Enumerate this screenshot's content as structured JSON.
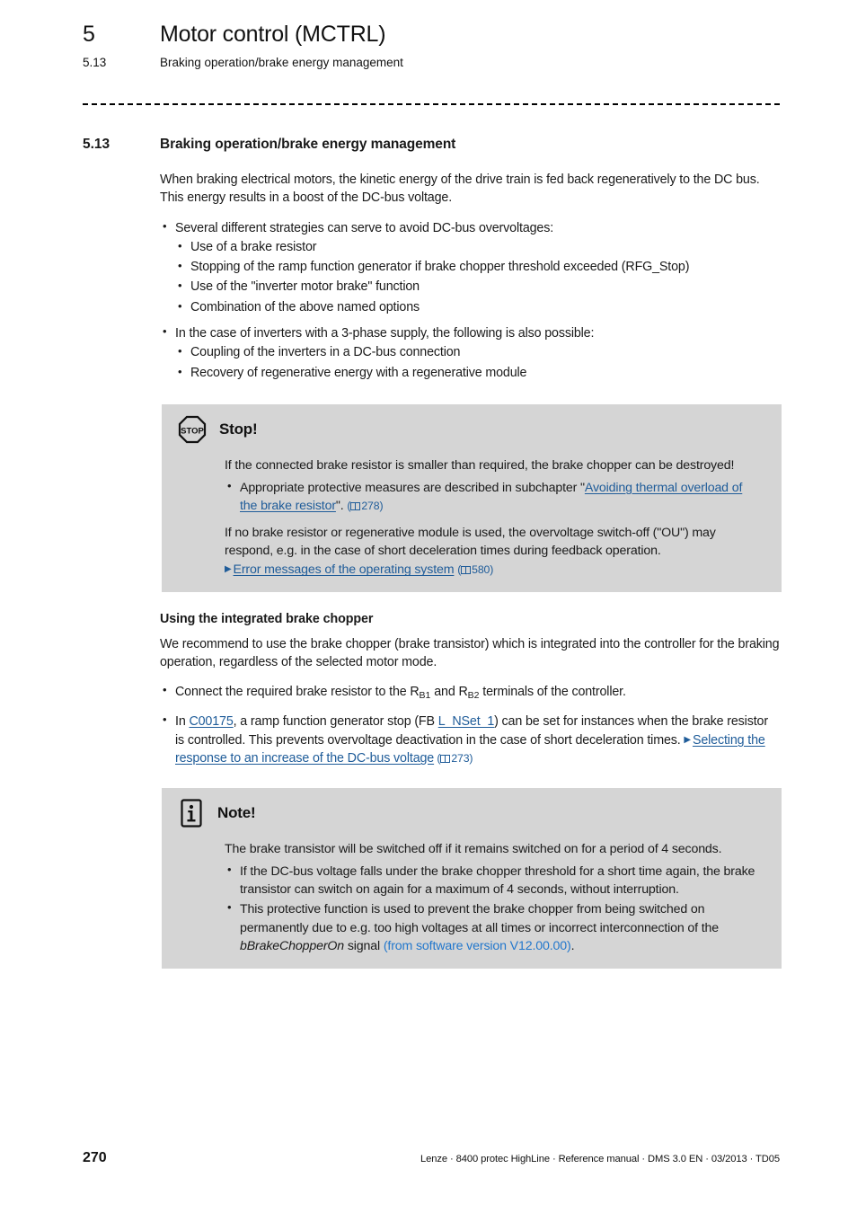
{
  "header": {
    "chapter_number": "5",
    "chapter_title": "Motor control (MCTRL)",
    "section_number": "5.13",
    "section_title": "Braking operation/brake energy management"
  },
  "section": {
    "number": "5.13",
    "title": "Braking operation/brake energy management"
  },
  "intro": {
    "paragraph": "When braking electrical motors, the kinetic energy of the drive train is fed back regeneratively to the DC bus. This energy results in a boost of the DC-bus voltage.",
    "bullets": [
      {
        "text": "Several different strategies can serve to avoid DC-bus overvoltages:",
        "sub": [
          "Use of a brake resistor",
          "Stopping of the ramp function generator if brake chopper threshold exceeded (RFG_Stop)",
          "Use of the \"inverter motor brake\" function",
          "Combination of the above named options"
        ]
      },
      {
        "text": "In the case of inverters with a 3-phase supply, the following is also possible:",
        "sub": [
          "Coupling of the inverters in a DC-bus connection",
          "Recovery of regenerative energy with a regenerative module"
        ]
      }
    ]
  },
  "stop_box": {
    "icon": "stop-octagon-icon",
    "title": "Stop!",
    "paragraph1": "If the connected brake resistor is smaller than required, the brake chopper can be destroyed!",
    "bullet1_prefix": "Appropriate protective measures are described in subchapter \"",
    "bullet1_link": "Avoiding thermal overload of the brake resistor",
    "bullet1_suffix": "\".",
    "bullet1_page": "278",
    "paragraph2": "If no brake resistor or regenerative module is used, the overvoltage switch-off (\"OU\") may respond, e.g. in the case of short deceleration times during feedback operation.",
    "link2": "Error messages of the operating system",
    "link2_page": "580"
  },
  "chopper": {
    "heading": "Using the integrated brake chopper",
    "paragraph": "We recommend to use the brake chopper (brake transistor) which is integrated into the controller for the braking operation, regardless of the selected motor mode.",
    "bullet1_a": "Connect the required brake resistor to the R",
    "bullet1_sub1": "B1",
    "bullet1_b": " and R",
    "bullet1_sub2": "B2",
    "bullet1_c": " terminals of the controller.",
    "bullet2_a": "In ",
    "bullet2_link1": "C00175",
    "bullet2_b": ", a ramp function generator stop (FB ",
    "bullet2_link2": "L_NSet_1",
    "bullet2_c": ") can be set for instances when the brake resistor is controlled. This prevents overvoltage deactivation in the case of short deceleration times. ",
    "bullet2_link3": "Selecting the response to an increase of the DC-bus voltage",
    "bullet2_page": "273"
  },
  "note_box": {
    "icon": "info-note-icon",
    "title": "Note!",
    "paragraph": "The brake transistor will be switched off if it remains switched on for a period of 4 seconds.",
    "bullet1": "If the DC-bus voltage falls under the brake chopper threshold for a short time again, the brake transistor can switch on again for a maximum of 4 seconds, without interruption.",
    "bullet2_a": "This protective function is used to prevent the brake chopper from being switched on permanently due to e.g. too high voltages at all times or incorrect interconnection of the ",
    "bullet2_italic": "bBrakeChopperOn",
    "bullet2_b": " signal ",
    "bullet2_blue": "(from software version V12.00.00)",
    "bullet2_c": "."
  },
  "footer": {
    "page_number": "270",
    "info": "Lenze · 8400 protec HighLine · Reference manual · DMS 3.0 EN · 03/2013 · TD05"
  },
  "colors": {
    "link_blue": "#1f5c99",
    "accent_blue": "#2277cc",
    "callout_bg": "#d5d5d5",
    "text": "#1a1a1a"
  }
}
